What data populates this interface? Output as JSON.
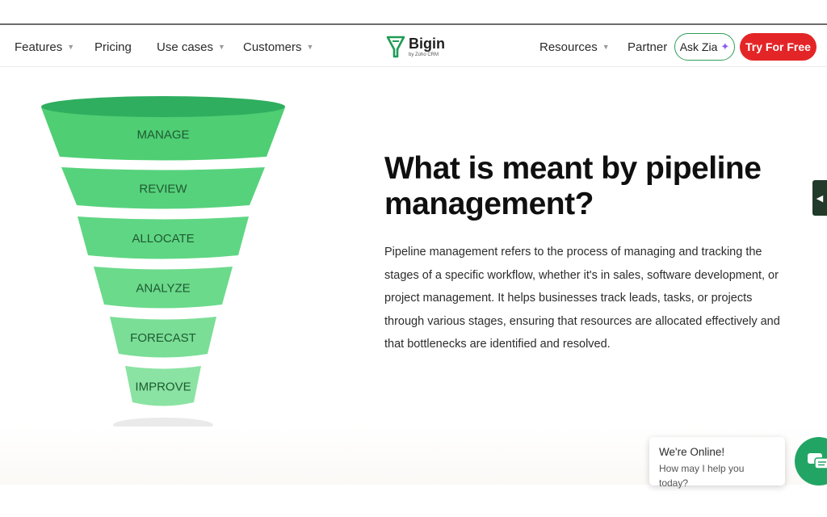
{
  "nav": {
    "left_items": [
      {
        "label": "Features",
        "dropdown": true
      },
      {
        "label": "Pricing",
        "dropdown": false
      },
      {
        "label": "Use cases",
        "dropdown": true
      },
      {
        "label": "Customers",
        "dropdown": true
      }
    ],
    "logo": {
      "title": "Bigin",
      "subtitle": "by Zoho CRM"
    },
    "right_items": [
      {
        "label": "Resources",
        "dropdown": true
      },
      {
        "label": "Partner",
        "dropdown": false
      }
    ],
    "ask_zia": "Ask Zia",
    "cta": "Try For Free"
  },
  "funnel": {
    "stages": [
      "MANAGE",
      "REVIEW",
      "ALLOCATE",
      "ANALYZE",
      "FORECAST",
      "IMPROVE"
    ],
    "colors": [
      "#4fce74",
      "#57d27c",
      "#5fd683",
      "#6bda8b",
      "#7ade96",
      "#8ae3a2"
    ],
    "rim_color": "#2fae5f",
    "label_color": "#1e5a32"
  },
  "content": {
    "heading": "What is meant by pipeline management?",
    "body": "Pipeline management refers to the process of managing and tracking the stages of a specific workflow, whether it's in sales, software development, or project management. It helps businesses track leads, tasks, or projects through various stages, ensuring that resources are allocated effectively and that bottlenecks are identified and resolved."
  },
  "chat": {
    "title": "We're Online!",
    "subtitle": "How may I help you today?"
  },
  "colors": {
    "brand_green": "#22a564",
    "cta_red": "#e42527",
    "zia_border": "#2e9e58"
  },
  "icons": {
    "caret": "chevron-down-icon",
    "logo": "bigin-logo-icon",
    "sparkle": "sparkle-icon",
    "chat": "chat-icon",
    "side_tab": "chevron-left-icon"
  }
}
